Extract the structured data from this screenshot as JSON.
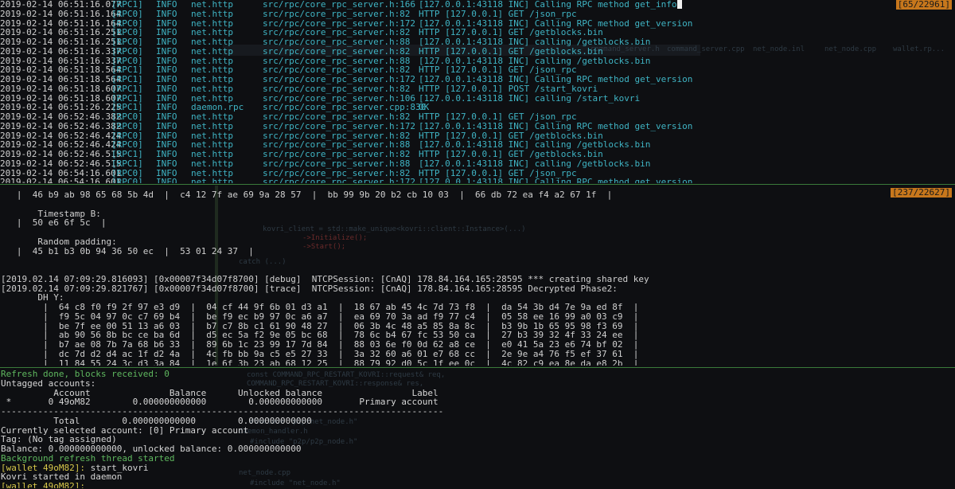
{
  "top_pane": {
    "counter": "[65/22961]",
    "rows": [
      {
        "ts": "2019-02-14 06:51:16.077",
        "thread": "[RPC1]",
        "level": "INFO",
        "cat": "net.http",
        "file": "src/rpc/core_rpc_server.h:166",
        "msg": "[127.0.0.1:43118 INC] Calling RPC method get_info"
      },
      {
        "ts": "2019-02-14 06:51:16.164",
        "thread": "[RPC0]",
        "level": "INFO",
        "cat": "net.http",
        "file": "src/rpc/core_rpc_server.h:82",
        "msg": "HTTP [127.0.0.1] GET /json_rpc"
      },
      {
        "ts": "2019-02-14 06:51:16.164",
        "thread": "[RPC0]",
        "level": "INFO",
        "cat": "net.http",
        "file": "src/rpc/core_rpc_server.h:172",
        "msg": "[127.0.0.1:43118 INC] Calling RPC method get_version"
      },
      {
        "ts": "2019-02-14 06:51:16.251",
        "thread": "[RPC0]",
        "level": "INFO",
        "cat": "net.http",
        "file": "src/rpc/core_rpc_server.h:82",
        "msg": "HTTP [127.0.0.1] GET /getblocks.bin"
      },
      {
        "ts": "2019-02-14 06:51:16.251",
        "thread": "[RPC0]",
        "level": "INFO",
        "cat": "net.http",
        "file": "src/rpc/core_rpc_server.h:88",
        "msg": "[127.0.0.1:43118 INC] calling /getblocks.bin"
      },
      {
        "ts": "2019-02-14 06:51:16.337",
        "thread": "[RPC0]",
        "level": "INFO",
        "cat": "net.http",
        "file": "src/rpc/core_rpc_server.h:82",
        "msg": "HTTP [127.0.0.1] GET /getblocks.bin"
      },
      {
        "ts": "2019-02-14 06:51:16.337",
        "thread": "[RPC0]",
        "level": "INFO",
        "cat": "net.http",
        "file": "src/rpc/core_rpc_server.h:88",
        "msg": "[127.0.0.1:43118 INC] calling /getblocks.bin"
      },
      {
        "ts": "2019-02-14 06:51:18.564",
        "thread": "[RPC1]",
        "level": "INFO",
        "cat": "net.http",
        "file": "src/rpc/core_rpc_server.h:82",
        "msg": "HTTP [127.0.0.1] GET /json_rpc"
      },
      {
        "ts": "2019-02-14 06:51:18.564",
        "thread": "[RPC1]",
        "level": "INFO",
        "cat": "net.http",
        "file": "src/rpc/core_rpc_server.h:172",
        "msg": "[127.0.0.1:43118 INC] Calling RPC method get_version"
      },
      {
        "ts": "2019-02-14 06:51:18.607",
        "thread": "[RPC1]",
        "level": "INFO",
        "cat": "net.http",
        "file": "src/rpc/core_rpc_server.h:82",
        "msg": "HTTP [127.0.0.1] POST /start_kovri"
      },
      {
        "ts": "2019-02-14 06:51:18.607",
        "thread": "[RPC1]",
        "level": "INFO",
        "cat": "net.http",
        "file": "src/rpc/core_rpc_server.h:106",
        "msg": "[127.0.0.1:43118 INC] calling /start_kovri"
      },
      {
        "ts": "2019-02-14 06:51:26.225",
        "thread": "[RPC1]",
        "level": "INFO",
        "cat": "daemon.rpc",
        "file": "src/rpc/core_rpc_server.cpp:830",
        "msg": "OK"
      },
      {
        "ts": "2019-02-14 06:52:46.382",
        "thread": "[RPC0]",
        "level": "INFO",
        "cat": "net.http",
        "file": "src/rpc/core_rpc_server.h:82",
        "msg": "HTTP [127.0.0.1] GET /json_rpc"
      },
      {
        "ts": "2019-02-14 06:52:46.382",
        "thread": "[RPC0]",
        "level": "INFO",
        "cat": "net.http",
        "file": "src/rpc/core_rpc_server.h:172",
        "msg": "[127.0.0.1:43118 INC] Calling RPC method get_version"
      },
      {
        "ts": "2019-02-14 06:52:46.424",
        "thread": "[RPC0]",
        "level": "INFO",
        "cat": "net.http",
        "file": "src/rpc/core_rpc_server.h:82",
        "msg": "HTTP [127.0.0.1] GET /getblocks.bin"
      },
      {
        "ts": "2019-02-14 06:52:46.424",
        "thread": "[RPC0]",
        "level": "INFO",
        "cat": "net.http",
        "file": "src/rpc/core_rpc_server.h:88",
        "msg": "[127.0.0.1:43118 INC] calling /getblocks.bin"
      },
      {
        "ts": "2019-02-14 06:52:46.515",
        "thread": "[RPC1]",
        "level": "INFO",
        "cat": "net.http",
        "file": "src/rpc/core_rpc_server.h:82",
        "msg": "HTTP [127.0.0.1] GET /getblocks.bin"
      },
      {
        "ts": "2019-02-14 06:52:46.515",
        "thread": "[RPC1]",
        "level": "INFO",
        "cat": "net.http",
        "file": "src/rpc/core_rpc_server.h:88",
        "msg": "[127.0.0.1:43118 INC] calling /getblocks.bin"
      },
      {
        "ts": "2019-02-14 06:54:16.601",
        "thread": "[RPC0]",
        "level": "INFO",
        "cat": "net.http",
        "file": "src/rpc/core_rpc_server.h:82",
        "msg": "HTTP [127.0.0.1] GET /json_rpc"
      },
      {
        "ts": "2019-02-14 06:54:16.601",
        "thread": "[RPC0]",
        "level": "INFO",
        "cat": "net.http",
        "file": "src/rpc/core_rpc_server.h:172",
        "msg": "[127.0.0.1:43118 INC] Calling RPC method get_version"
      }
    ]
  },
  "mid_pane": {
    "counter": "[237/22627]",
    "lines": [
      "   |  46 b9 ab 98 65 68 5b 4d  |  c4 12 7f ae 69 9a 28 57  |  bb 99 9b 20 b2 cb 10 03  |  66 db 72 ea f4 a2 67 1f  |",
      "",
      "       Timestamp B:",
      "   |  50 e6 6f 5c  |",
      "",
      "       Random padding:",
      "   |  45 b1 b3 0b 94 36 50 ec  |  53 01 24 37  |",
      "",
      "",
      "[2019.02.14 07:09:29.816093] [0x00007f34d07f8700] [debug]  NTCPSession: [CnAQ] 178.84.164.165:28595 *** creating shared key",
      "[2019.02.14 07:09:29.821767] [0x00007f34d07f8700] [trace]  NTCPSession: [CnAQ] 178.84.164.165:28595 Decrypted Phase2:",
      "       DH Y:",
      "        |  64 c8 f0 f9 2f 97 e3 d9  |  04 cf 44 9f 6b 01 d3 a1  |  18 67 ab 45 4c 7d 73 f8  |  da 54 3b d4 7e 9a ed 8f  |",
      "        |  f9 5c 04 97 0c c7 69 b4  |  be f9 ec b9 97 0c a6 a7  |  ea 69 70 3a ad f9 77 c4  |  05 58 ee 16 99 a0 03 c9  |",
      "        |  be 7f ee 00 51 13 a6 03  |  b7 c7 8b c1 61 90 48 27  |  06 3b 4c 48 a5 85 8a 8c  |  b3 9b 1b 65 95 98 f3 69  |",
      "        |  ab 90 56 8b bc ce ba 6d  |  d5 ec 5a f2 9e 05 bc 68  |  78 6c b4 67 fc 53 50 ca  |  27 b3 39 32 4f 33 24 ee  |",
      "        |  b7 ae 08 7b 7a 68 b6 33  |  89 6b 1c 23 99 17 7d 84  |  88 03 6e f0 0d 62 a8 ce  |  e0 41 5a 23 e6 74 bf 02  |",
      "        |  dc 7d d2 d4 ac 1f d2 4a  |  4c fb bb 9a c5 e5 27 33  |  3a 32 60 a6 01 e7 68 cc  |  2e 9e a4 76 f5 ef 37 61  |",
      "        |  11 84 55 24 3c d3 3a 84  |  1e 6f 3b 23 ab 68 12 25  |  88 79 92 d0 5c 1f ee 0c  |  4c 82 c9 ea 8e da e8 2b  |"
    ]
  },
  "bot_pane": {
    "refresh_done": "Refresh done, blocks received: 0",
    "untagged": "Untagged accounts:",
    "header": "          Account               Balance      Unlocked balance                 Label",
    "row": " *       0 49oM82        0.000000000000        0.000000000000       Primary account",
    "rule": "------------------------------------------------------------------------------------",
    "total": "          Total        0.000000000000        0.000000000000",
    "current": "Currently selected account: [0] Primary account",
    "tag": "Tag: (No tag assigned)",
    "balance": "Balance: 0.000000000000, unlocked balance: 0.000000000000",
    "bg_refresh": "Background refresh thread started",
    "prompt1": "[wallet 49oM82]:",
    "cmd1": " start_kovri",
    "kovri_started": "Kovri started in daemon",
    "prompt2": "[wallet 49oM82]:"
  },
  "ghost_text": {
    "tab1": "command_server.h",
    "tab2": "command_server.cpp",
    "tab3": "net_node.inl",
    "tab4": "net_node.cpp",
    "tab5": "wallet.rp...",
    "code1": "kovri_client = std::make_unique<kovri::client::Instance>(...)",
    "code2": "->Initialize();",
    "code3": "->Start();",
    "code4": "catch (...)",
    "code5": "const COMMAND_RPC_RESTART_KOVRI::request& req,",
    "code6": "COMMAND_RPC_RESTART_KOVRI::response& res,",
    "inc1": "#include \"p2p/net_node.h\"",
    "inc2": "#include \"p2p/p2p_node.h\"",
    "inc3": "#include \"net_node.h\"",
    "file1": "daemon_handler.h",
    "file2": "net_node.cpp"
  }
}
